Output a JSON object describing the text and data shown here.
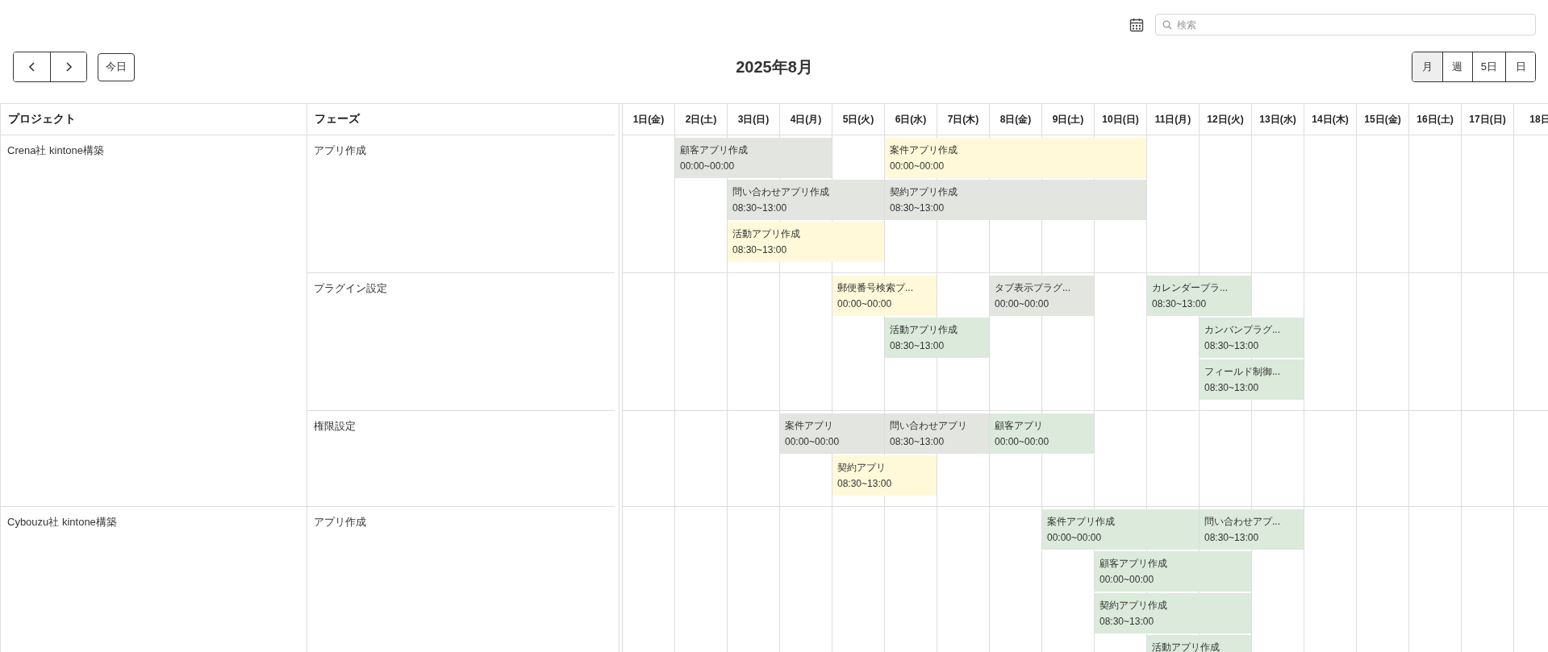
{
  "toolbar": {
    "search": {
      "placeholder": "検索"
    },
    "today_button": "今日",
    "title": "2025年8月",
    "views": [
      {
        "label": "月",
        "selected": true
      },
      {
        "label": "週",
        "selected": false
      },
      {
        "label": "5日",
        "selected": false
      },
      {
        "label": "日",
        "selected": false
      }
    ]
  },
  "table": {
    "columns": [
      "プロジェクト",
      "フェーズ"
    ],
    "days": [
      "1日(金)",
      "2日(土)",
      "3日(日)",
      "4日(月)",
      "5日(火)",
      "6日(水)",
      "7日(木)",
      "8日(金)",
      "9日(土)",
      "10日(日)",
      "11日(月)",
      "12日(火)",
      "13日(水)",
      "14日(木)",
      "15日(金)",
      "16日(土)",
      "17日(日)",
      "18日"
    ]
  },
  "projects": [
    {
      "name": "Crena社 kintone構築",
      "phases": [
        {
          "name": "アプリ作成",
          "lanes": [
            [
              {
                "kind": "empty"
              },
              {
                "kind": "event",
                "title": "顧客アプリ作成",
                "time": "00:00~00:00",
                "color": "#e3e5e1"
              },
              {
                "kind": "continued"
              },
              {
                "kind": "continued"
              },
              {
                "kind": "empty"
              },
              {
                "kind": "event",
                "title": "案件アプリ作成",
                "time": "00:00~00:00",
                "color": "#fff9d9"
              },
              {
                "kind": "continued"
              },
              {
                "kind": "continued"
              },
              {
                "kind": "continued"
              },
              {
                "kind": "continued"
              }
            ],
            [
              {
                "kind": "empty"
              },
              {
                "kind": "empty"
              },
              {
                "kind": "event",
                "title": "問い合わせアプリ作成",
                "time": "08:30~13:00",
                "color": "#e3e5e1"
              },
              {
                "kind": "continued"
              },
              {
                "kind": "continued"
              },
              {
                "kind": "event",
                "title": "契約アプリ作成",
                "time": "08:30~13:00",
                "color": "#e3e5e1"
              },
              {
                "kind": "continued"
              },
              {
                "kind": "continued"
              },
              {
                "kind": "continued"
              },
              {
                "kind": "continued"
              }
            ],
            [
              {
                "kind": "empty"
              },
              {
                "kind": "empty"
              },
              {
                "kind": "event",
                "title": "活動アプリ作成",
                "time": "08:30~13:00",
                "color": "#fff9d9"
              },
              {
                "kind": "continued"
              },
              {
                "kind": "continued"
              }
            ]
          ]
        },
        {
          "name": "プラグイン設定",
          "lanes": [
            [
              {
                "kind": "empty"
              },
              {
                "kind": "empty"
              },
              {
                "kind": "empty"
              },
              {
                "kind": "empty"
              },
              {
                "kind": "event",
                "title": "郵便番号検索プ...",
                "time": "00:00~00:00",
                "color": "#fff9d9"
              },
              {
                "kind": "continued"
              },
              {
                "kind": "empty"
              },
              {
                "kind": "event",
                "title": "タブ表示プラグ...",
                "time": "00:00~00:00",
                "color": "#e3e5e1"
              },
              {
                "kind": "continued"
              },
              {
                "kind": "empty"
              },
              {
                "kind": "event",
                "title": "カレンダープラ...",
                "time": "08:30~13:00",
                "color": "#dbeadb"
              },
              {
                "kind": "continued"
              }
            ],
            [
              {
                "kind": "empty"
              },
              {
                "kind": "empty"
              },
              {
                "kind": "empty"
              },
              {
                "kind": "empty"
              },
              {
                "kind": "empty"
              },
              {
                "kind": "event",
                "title": "活動アプリ作成",
                "time": "08:30~13:00",
                "color": "#dbeadb"
              },
              {
                "kind": "continued"
              },
              {
                "kind": "empty"
              },
              {
                "kind": "empty"
              },
              {
                "kind": "empty"
              },
              {
                "kind": "empty"
              },
              {
                "kind": "event",
                "title": "カンバンプラグ...",
                "time": "08:30~13:00",
                "color": "#dbeadb"
              },
              {
                "kind": "continued"
              }
            ],
            [
              {
                "kind": "empty"
              },
              {
                "kind": "empty"
              },
              {
                "kind": "empty"
              },
              {
                "kind": "empty"
              },
              {
                "kind": "empty"
              },
              {
                "kind": "empty"
              },
              {
                "kind": "empty"
              },
              {
                "kind": "empty"
              },
              {
                "kind": "empty"
              },
              {
                "kind": "empty"
              },
              {
                "kind": "empty"
              },
              {
                "kind": "event",
                "title": "フィールド制御...",
                "time": "08:30~13:00",
                "color": "#dbeadb"
              },
              {
                "kind": "continued"
              }
            ]
          ]
        },
        {
          "name": "権限設定",
          "lanes": [
            [
              {
                "kind": "empty"
              },
              {
                "kind": "empty"
              },
              {
                "kind": "empty"
              },
              {
                "kind": "event",
                "title": "案件アプリ",
                "time": "00:00~00:00",
                "color": "#e3e5e1"
              },
              {
                "kind": "continued"
              },
              {
                "kind": "event",
                "title": "問い合わせアプリ",
                "time": "08:30~13:00",
                "color": "#e3e5e1"
              },
              {
                "kind": "continued"
              },
              {
                "kind": "event",
                "title": "顧客アプリ",
                "time": "00:00~00:00",
                "color": "#dbeadb"
              },
              {
                "kind": "continued"
              }
            ],
            [
              {
                "kind": "empty"
              },
              {
                "kind": "empty"
              },
              {
                "kind": "empty"
              },
              {
                "kind": "empty"
              },
              {
                "kind": "event",
                "title": "契約アプリ",
                "time": "08:30~13:00",
                "color": "#fff9d9"
              },
              {
                "kind": "continued"
              }
            ]
          ]
        }
      ]
    },
    {
      "name": "Cybouzu社 kintone構築",
      "phases": [
        {
          "name": "アプリ作成",
          "lanes": [
            [
              {
                "kind": "empty"
              },
              {
                "kind": "empty"
              },
              {
                "kind": "empty"
              },
              {
                "kind": "empty"
              },
              {
                "kind": "empty"
              },
              {
                "kind": "empty"
              },
              {
                "kind": "empty"
              },
              {
                "kind": "empty"
              },
              {
                "kind": "event",
                "title": "案件アプリ作成",
                "time": "00:00~00:00",
                "color": "#dbeadb"
              },
              {
                "kind": "continued"
              },
              {
                "kind": "continued"
              },
              {
                "kind": "event",
                "title": "問い合わせアプ...",
                "time": "08:30~13:00",
                "color": "#dbeadb"
              },
              {
                "kind": "continued"
              }
            ],
            [
              {
                "kind": "empty"
              },
              {
                "kind": "empty"
              },
              {
                "kind": "empty"
              },
              {
                "kind": "empty"
              },
              {
                "kind": "empty"
              },
              {
                "kind": "empty"
              },
              {
                "kind": "empty"
              },
              {
                "kind": "empty"
              },
              {
                "kind": "empty"
              },
              {
                "kind": "event",
                "title": "顧客アプリ作成",
                "time": "00:00~00:00",
                "color": "#dbeadb"
              },
              {
                "kind": "continued"
              },
              {
                "kind": "continued"
              }
            ],
            [
              {
                "kind": "empty"
              },
              {
                "kind": "empty"
              },
              {
                "kind": "empty"
              },
              {
                "kind": "empty"
              },
              {
                "kind": "empty"
              },
              {
                "kind": "empty"
              },
              {
                "kind": "empty"
              },
              {
                "kind": "empty"
              },
              {
                "kind": "empty"
              },
              {
                "kind": "event",
                "title": "契約アプリ作成",
                "time": "08:30~13:00",
                "color": "#dbeadb"
              },
              {
                "kind": "continued"
              },
              {
                "kind": "continued"
              }
            ],
            [
              {
                "kind": "empty"
              },
              {
                "kind": "empty"
              },
              {
                "kind": "empty"
              },
              {
                "kind": "empty"
              },
              {
                "kind": "empty"
              },
              {
                "kind": "empty"
              },
              {
                "kind": "empty"
              },
              {
                "kind": "empty"
              },
              {
                "kind": "empty"
              },
              {
                "kind": "empty"
              },
              {
                "kind": "event",
                "title": "活動アプリ作成",
                "color": "#dbeadb"
              },
              {
                "kind": "continued"
              }
            ]
          ]
        }
      ]
    }
  ]
}
